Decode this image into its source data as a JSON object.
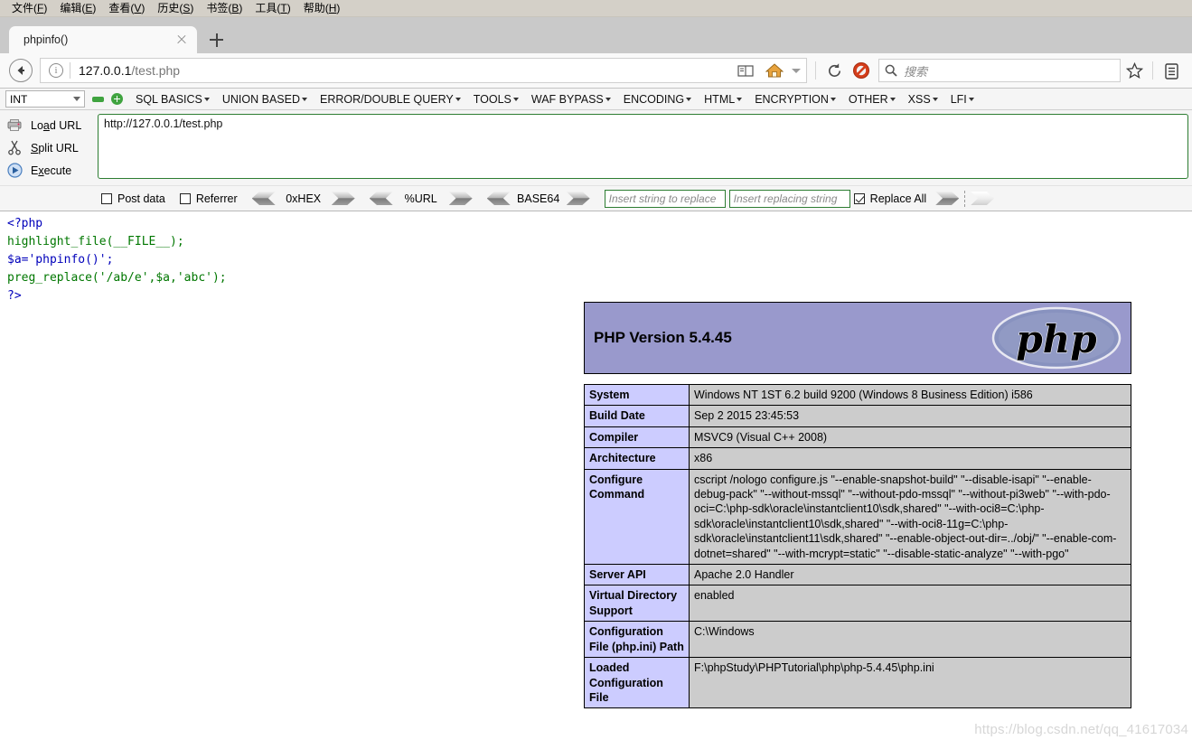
{
  "browser": {
    "menubar": [
      {
        "label": "文件",
        "accel": "F"
      },
      {
        "label": "编辑",
        "accel": "E"
      },
      {
        "label": "查看",
        "accel": "V"
      },
      {
        "label": "历史",
        "accel": "S"
      },
      {
        "label": "书签",
        "accel": "B"
      },
      {
        "label": "工具",
        "accel": "T"
      },
      {
        "label": "帮助",
        "accel": "H"
      }
    ],
    "tab": {
      "title": "phpinfo()",
      "close_icon": "close-icon",
      "newtab_icon": "plus-icon"
    },
    "nav": {
      "back_icon": "back-arrow-icon",
      "info_icon": "info-icon",
      "url_host": "127.0.0.1",
      "url_path": "/test.php",
      "reader_icon": "reader-mode-icon",
      "home_icon": "home-icon",
      "dropdown_icon": "chevron-down-icon",
      "reload_icon": "reload-icon",
      "noscript_icon": "noscript-blocked-icon",
      "bookmark_icon": "star-icon",
      "menu_icon": "library-icon"
    },
    "search": {
      "placeholder": "搜索",
      "icon": "search-icon"
    }
  },
  "hackbar": {
    "type_select": {
      "value": "INT",
      "icon": "chevron-down-icon"
    },
    "minus_icon": "minus-button-icon",
    "plus_icon": "plus-button-icon",
    "menus": [
      {
        "label": "SQL BASICS"
      },
      {
        "label": "UNION BASED"
      },
      {
        "label": "ERROR/DOUBLE QUERY"
      },
      {
        "label": "TOOLS"
      },
      {
        "label": "WAF BYPASS"
      },
      {
        "label": "ENCODING"
      },
      {
        "label": "HTML"
      },
      {
        "label": "ENCRYPTION"
      },
      {
        "label": "OTHER"
      },
      {
        "label": "XSS"
      },
      {
        "label": "LFI"
      }
    ],
    "actions": [
      {
        "label_pre": "Lo",
        "label_accel": "a",
        "label_post": "d URL",
        "icon": "load-url-icon"
      },
      {
        "label_pre": "",
        "label_accel": "S",
        "label_post": "plit URL",
        "icon": "split-url-scissors-icon"
      },
      {
        "label_pre": "E",
        "label_accel": "x",
        "label_post": "ecute",
        "icon": "execute-play-icon"
      }
    ],
    "url_value": "http://127.0.0.1/test.php",
    "post_data": {
      "label": "Post data",
      "checked": false
    },
    "referrer": {
      "label": "Referrer",
      "checked": false
    },
    "encoders": [
      {
        "label": "0xHEX"
      },
      {
        "label": "%URL"
      },
      {
        "label": "BASE64"
      }
    ],
    "replace_search_placeholder": "Insert string to replace",
    "replace_with_placeholder": "Insert replacing string",
    "replace_all": {
      "label": "Replace All",
      "checked": true
    }
  },
  "php_source": {
    "lines": [
      "<?php",
      "highlight_file(__FILE__);",
      "$a='phpinfo()';",
      "preg_replace('/ab/e',$a,'abc');",
      "?>"
    ]
  },
  "phpinfo": {
    "version_title": "PHP Version 5.4.45",
    "logo_text": "php",
    "rows": [
      {
        "key": "System",
        "value": "Windows NT 1ST 6.2 build 9200 (Windows 8 Business Edition) i586"
      },
      {
        "key": "Build Date",
        "value": "Sep 2 2015 23:45:53"
      },
      {
        "key": "Compiler",
        "value": "MSVC9 (Visual C++ 2008)"
      },
      {
        "key": "Architecture",
        "value": "x86"
      },
      {
        "key": "Configure Command",
        "value": "cscript /nologo configure.js \"--enable-snapshot-build\" \"--disable-isapi\" \"--enable-debug-pack\" \"--without-mssql\" \"--without-pdo-mssql\" \"--without-pi3web\" \"--with-pdo-oci=C:\\php-sdk\\oracle\\instantclient10\\sdk,shared\" \"--with-oci8=C:\\php-sdk\\oracle\\instantclient10\\sdk,shared\" \"--with-oci8-11g=C:\\php-sdk\\oracle\\instantclient11\\sdk,shared\" \"--enable-object-out-dir=../obj/\" \"--enable-com-dotnet=shared\" \"--with-mcrypt=static\" \"--disable-static-analyze\" \"--with-pgo\""
      },
      {
        "key": "Server API",
        "value": "Apache 2.0 Handler"
      },
      {
        "key": "Virtual Directory Support",
        "value": "enabled"
      },
      {
        "key": "Configuration File (php.ini) Path",
        "value": "C:\\Windows"
      },
      {
        "key": "Loaded Configuration File",
        "value": "F:\\phpStudy\\PHPTutorial\\php\\php-5.4.45\\php.ini"
      }
    ]
  },
  "watermark": "https://blog.csdn.net/qq_41617034",
  "colors": {
    "php_header_bg": "#9999cc",
    "php_key_bg": "#ccccff",
    "php_value_bg": "#cccccc",
    "hackbar_green": "#2d7d32",
    "menubar_bg": "#d4d0c8"
  }
}
